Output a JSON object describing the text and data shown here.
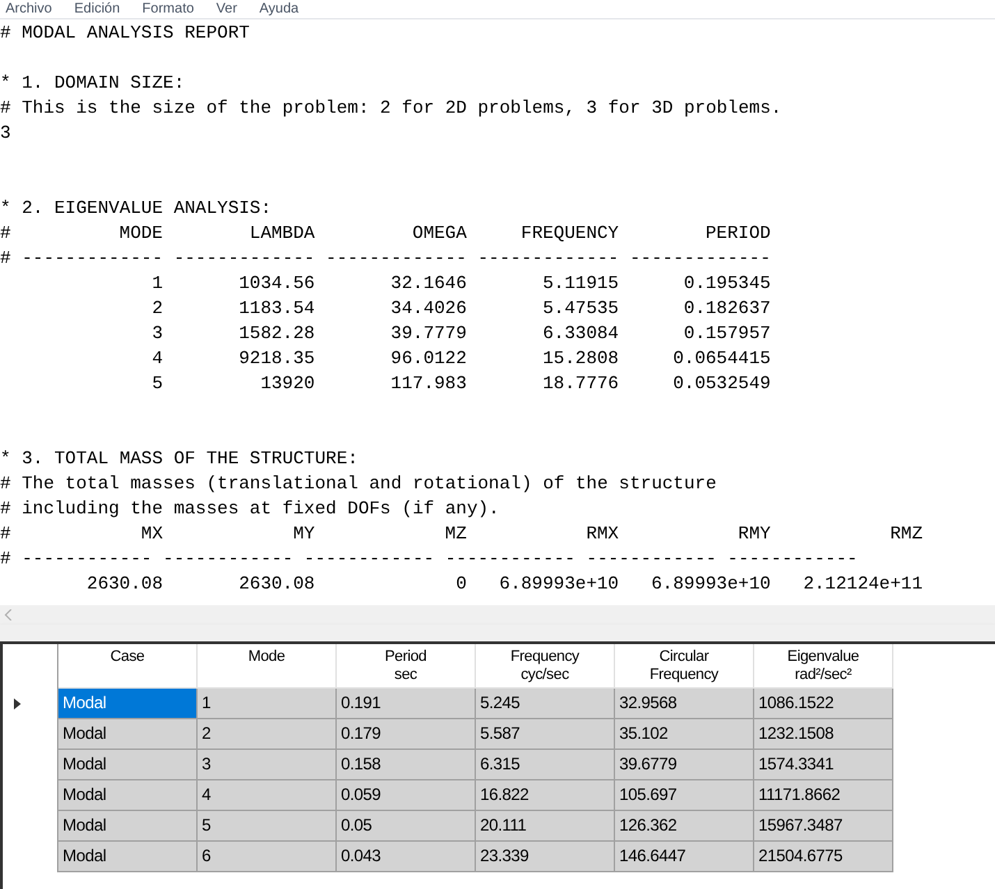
{
  "menu_bar": [
    "Archivo",
    "Edición",
    "Formato",
    "Ver",
    "Ayuda"
  ],
  "report": {
    "title": "# MODAL ANALYSIS REPORT",
    "sections": [
      {
        "heading": "* 1. DOMAIN SIZE:",
        "comments": [
          "# This is the size of the problem: 2 for 2D problems, 3 for 3D problems."
        ],
        "value": "3"
      },
      {
        "heading": "* 2. EIGENVALUE ANALYSIS:",
        "table": {
          "prefix": "#",
          "columns": [
            "MODE",
            "LAMBDA",
            "OMEGA",
            "FREQUENCY",
            "PERIOD"
          ],
          "separator": "# ------------- ------------- ------------- ------------- -------------",
          "rows": [
            [
              "1",
              "1034.56",
              "32.1646",
              "5.11915",
              "0.195345"
            ],
            [
              "2",
              "1183.54",
              "34.4026",
              "5.47535",
              "0.182637"
            ],
            [
              "3",
              "1582.28",
              "39.7779",
              "6.33084",
              "0.157957"
            ],
            [
              "4",
              "9218.35",
              "96.0122",
              "15.2808",
              "0.0654415"
            ],
            [
              "5",
              "13920",
              "117.983",
              "18.7776",
              "0.0532549"
            ]
          ]
        }
      },
      {
        "heading": "* 3. TOTAL MASS OF THE STRUCTURE:",
        "comments": [
          "# The total masses (translational and rotational) of the structure",
          "# including the masses at fixed DOFs (if any)."
        ],
        "table": {
          "prefix": "#",
          "columns": [
            "MX",
            "MY",
            "MZ",
            "RMX",
            "RMY",
            "RMZ"
          ],
          "separator": "# ------------ ------------ ------------ ------------ ------------ ------------",
          "rows": [
            [
              "2630.08",
              "2630.08",
              "0",
              "6.89993e+10",
              "6.89993e+10",
              "2.12124e+11"
            ]
          ]
        }
      }
    ]
  },
  "grid": {
    "columns": [
      {
        "label": "Case"
      },
      {
        "label": "Mode"
      },
      {
        "label": "Period",
        "unit": "sec"
      },
      {
        "label": "Frequency",
        "unit": "cyc/sec"
      },
      {
        "label": "Circular",
        "unit": "Frequency"
      },
      {
        "label": "Eigenvalue",
        "unit": "rad²/sec²"
      }
    ],
    "rows": [
      {
        "current": true,
        "cells": [
          {
            "text": "Modal",
            "selected": true
          },
          {
            "text": "1",
            "selected": false
          },
          {
            "text": "0.191",
            "selected": false
          },
          {
            "text": "5.245",
            "selected": false
          },
          {
            "text": "32.9568",
            "selected": false
          },
          {
            "text": "1086.1522",
            "selected": false
          }
        ]
      },
      {
        "current": false,
        "cells": [
          {
            "text": "Modal",
            "selected": false
          },
          {
            "text": "2",
            "selected": false
          },
          {
            "text": "0.179",
            "selected": false
          },
          {
            "text": "5.587",
            "selected": false
          },
          {
            "text": "35.102",
            "selected": false
          },
          {
            "text": "1232.1508",
            "selected": false
          }
        ]
      },
      {
        "current": false,
        "cells": [
          {
            "text": "Modal",
            "selected": false
          },
          {
            "text": "3",
            "selected": false
          },
          {
            "text": "0.158",
            "selected": false
          },
          {
            "text": "6.315",
            "selected": false
          },
          {
            "text": "39.6779",
            "selected": false
          },
          {
            "text": "1574.3341",
            "selected": false
          }
        ]
      },
      {
        "current": false,
        "cells": [
          {
            "text": "Modal",
            "selected": false
          },
          {
            "text": "4",
            "selected": false
          },
          {
            "text": "0.059",
            "selected": false
          },
          {
            "text": "16.822",
            "selected": false
          },
          {
            "text": "105.697",
            "selected": false
          },
          {
            "text": "11171.8662",
            "selected": false
          }
        ]
      },
      {
        "current": false,
        "cells": [
          {
            "text": "Modal",
            "selected": false
          },
          {
            "text": "5",
            "selected": false
          },
          {
            "text": "0.05",
            "selected": false
          },
          {
            "text": "20.111",
            "selected": false
          },
          {
            "text": "126.362",
            "selected": false
          },
          {
            "text": "15967.3487",
            "selected": false
          }
        ]
      },
      {
        "current": false,
        "cells": [
          {
            "text": "Modal",
            "selected": false
          },
          {
            "text": "6",
            "selected": false
          },
          {
            "text": "0.043",
            "selected": false
          },
          {
            "text": "23.339",
            "selected": false
          },
          {
            "text": "146.6447",
            "selected": false
          },
          {
            "text": "21504.6775",
            "selected": false
          }
        ]
      }
    ]
  }
}
